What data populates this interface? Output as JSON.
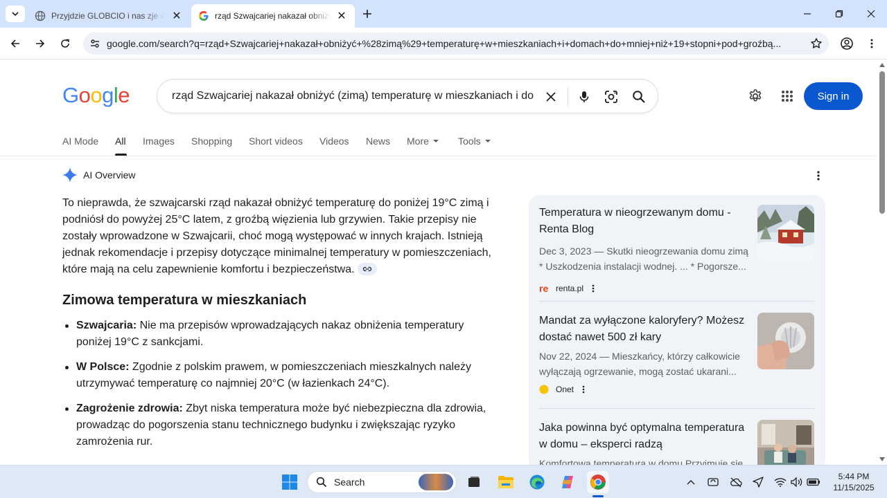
{
  "browser": {
    "tabs": [
      {
        "title": "Przyjdzie GLOBCIO i nas zje - St",
        "active": false,
        "favicon": "globe-icon"
      },
      {
        "title": "rząd Szwajcariej nakazał obniży",
        "active": true,
        "favicon": "google-g-icon"
      }
    ],
    "url": "google.com/search?q=rząd+Szwajcariej+nakazał+obniżyć+%28zimą%29+temperaturę+w+mieszkaniach+i+domach+do+mniej+niż+19+stopni+pod+groźbą..."
  },
  "google": {
    "logo_letters": [
      "G",
      "o",
      "o",
      "g",
      "l",
      "e"
    ],
    "logo_colors": [
      "#4285f4",
      "#ea4335",
      "#fbbc05",
      "#4285f4",
      "#34a853",
      "#ea4335"
    ],
    "query": "rząd Szwajcariej nakazał obniżyć (zimą) temperaturę w mieszkaniach i do",
    "sign_in": "Sign in",
    "tabs": [
      "AI Mode",
      "All",
      "Images",
      "Shopping",
      "Short videos",
      "Videos",
      "News",
      "More",
      "Tools"
    ]
  },
  "ai_overview": {
    "label": "AI Overview",
    "intro": "To nieprawda, że szwajcarski rząd nakazał obniżyć temperaturę do poniżej 19°C zimą i podniósł do powyżej 25°C latem, z groźbą więzienia lub grzywien. Takie przepisy nie zostały wprowadzone w Szwajcarii, choć mogą występować w innych krajach. Istnieją jednak rekomendacje i przepisy dotyczące minimalnej temperatury w pomieszczeniach, które mają na celu zapewnienie komfortu i bezpieczeństwa.",
    "heading": "Zimowa temperatura w mieszkaniach",
    "bullets": [
      {
        "bold": "Szwajcaria:",
        "text": " Nie ma przepisów wprowadzających nakaz obniżenia temperatury poniżej 19°C z sankcjami."
      },
      {
        "bold": "W Polsce:",
        "text": " Zgodnie z polskim prawem, w pomieszczeniach mieszkalnych należy utrzymywać temperaturę co najmniej 20°C (w łazienkach 24°C)."
      },
      {
        "bold": "Zagrożenie zdrowia:",
        "text": " Zbyt niska temperatura może być niebezpieczna dla zdrowia, prowadząc do pogorszenia stanu technicznego budynku i zwiększając ryzyko zamrożenia rur."
      }
    ]
  },
  "sources": [
    {
      "title": "Temperatura w nieogrzewanym domu - Renta Blog",
      "snippet_line1": "Dec 3, 2023 — Skutki nieogrzewania domu zimą",
      "snippet_line2": "* Uszkodzenia instalacji wodnej. ... * Pogorsze...",
      "site": "renta.pl",
      "site_icon": "renta-logo-icon",
      "site_color": "#e8430f"
    },
    {
      "title": "Mandat za wyłączone kaloryfery? Możesz dostać nawet 500 zł kary",
      "snippet_line1": "Nov 22, 2024 — Mieszkańcy, którzy całkowicie",
      "snippet_line2": "wyłączają ogrzewanie, mogą zostać ukarani...",
      "site": "Onet",
      "site_icon": "onet-logo-icon",
      "site_color": "#f5c400"
    },
    {
      "title": "Jaka powinna być optymalna temperatura w domu – eksperci radzą",
      "snippet_line1": "Komfortowa temperatura w domu Przyjmuje się",
      "snippet_line2": "",
      "site": "",
      "site_icon": "",
      "site_color": ""
    }
  ],
  "taskbar": {
    "search_label": "Search",
    "time": "5:44 PM",
    "date": "11/15/2025"
  }
}
